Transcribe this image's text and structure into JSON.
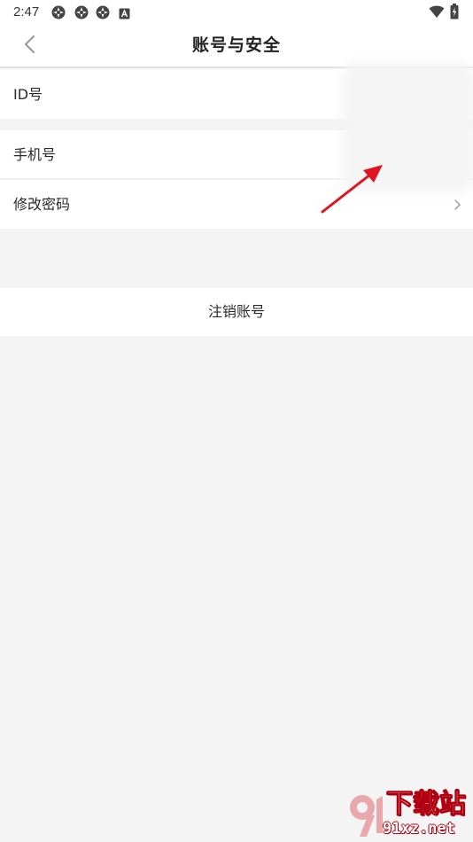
{
  "status_bar": {
    "time": "2:47",
    "left_icons": [
      "app-notification-icon",
      "app-notification-icon",
      "app-notification-icon",
      "keyboard-a-icon"
    ],
    "right_icons": [
      "wifi-icon",
      "battery-charging-icon"
    ]
  },
  "header": {
    "back_icon": "chevron-left-icon",
    "title": "账号与安全"
  },
  "rows": {
    "id": {
      "label": "ID号"
    },
    "phone": {
      "label": "手机号"
    },
    "password": {
      "label": "修改密码",
      "icon": "chevron-right-icon"
    }
  },
  "cancel_account": {
    "label": "注销账号"
  },
  "annotation": {
    "icon": "red-arrow-icon",
    "color": "#e0141e"
  },
  "watermark": {
    "top_text": "下载站",
    "bottom_text": "91xz.net",
    "logo_icon": "91-logo-icon"
  },
  "colors": {
    "background": "#f4f4f4",
    "surface": "#ffffff",
    "text": "#222222",
    "divider": "#e2e2e2",
    "annotation_red": "#e0141e"
  }
}
